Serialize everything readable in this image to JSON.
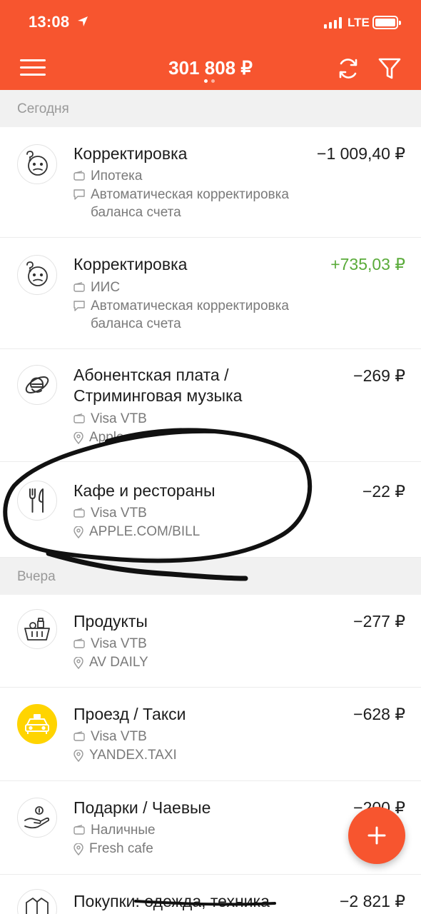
{
  "status_bar": {
    "time": "13:08",
    "network": "LTE"
  },
  "header": {
    "balance": "301 808 ₽"
  },
  "sections": [
    {
      "label": "Сегодня"
    },
    {
      "label": "Вчера"
    }
  ],
  "transactions": [
    {
      "title": "Корректировка",
      "amount": "−1 009,40 ₽",
      "account": "Ипотека",
      "note": "Автоматическая корректировка баланса счета",
      "icon": "confused-face-icon"
    },
    {
      "title": "Корректировка",
      "amount": "+735,03 ₽",
      "account": "ИИС",
      "note": "Автоматическая корректировка баланса счета",
      "icon": "confused-face-icon"
    },
    {
      "title": "Абонентская плата / Стриминговая музыка",
      "amount": "−269 ₽",
      "account": "Visa VTB",
      "place": "Apple",
      "icon": "internet-explorer-icon"
    },
    {
      "title": "Кафе и рестораны",
      "amount": "−22 ₽",
      "account": "Visa VTB",
      "place": "APPLE.COM/BILL",
      "icon": "fork-knife-icon"
    },
    {
      "title": "Продукты",
      "amount": "−277 ₽",
      "account": "Visa VTB",
      "place": "AV DAILY",
      "icon": "grocery-basket-icon"
    },
    {
      "title": "Проезд / Такси",
      "amount": "−628 ₽",
      "account": "Visa VTB",
      "place": "YANDEX.TAXI",
      "icon": "taxi-icon"
    },
    {
      "title": "Подарки / Чаевые",
      "amount": "−200 ₽",
      "account": "Наличные",
      "place": "Fresh cafe",
      "icon": "hand-coin-icon"
    },
    {
      "title": "Покупки: одежда, техника",
      "amount": "−2 821 ₽",
      "icon": "jacket-icon"
    }
  ],
  "colors": {
    "brand": "#f7552f",
    "positive": "#5aab3a",
    "ink": "#111111"
  }
}
